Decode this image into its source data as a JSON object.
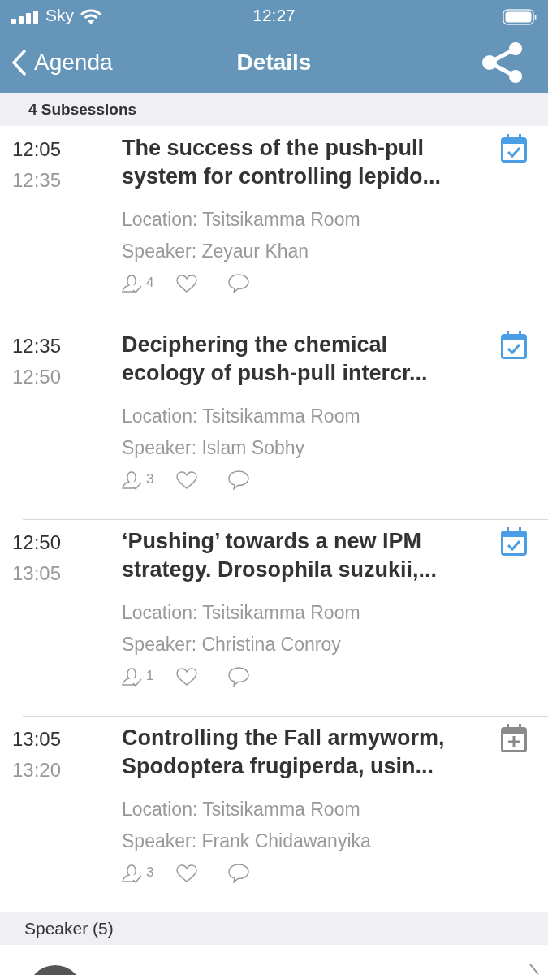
{
  "status_bar": {
    "carrier": "Sky",
    "time": "12:27"
  },
  "nav": {
    "back_label": "Agenda",
    "title": "Details"
  },
  "subsessions_header": "4 Subsessions",
  "sessions": [
    {
      "start": "12:05",
      "end": "12:35",
      "title": "The success of the push-pull system for controlling lepido...",
      "location": "Location: Tsitsikamma Room",
      "speaker": "Speaker: Zeyaur Khan",
      "attendees": "4",
      "in_calendar": true
    },
    {
      "start": "12:35",
      "end": "12:50",
      "title": "Deciphering the chemical ecology of push-pull intercr...",
      "location": "Location: Tsitsikamma Room",
      "speaker": "Speaker: Islam Sobhy",
      "attendees": "3",
      "in_calendar": true
    },
    {
      "start": "12:50",
      "end": "13:05",
      "title": "‘Pushing’ towards a new IPM strategy. Drosophila suzukii,...",
      "location": "Location: Tsitsikamma Room",
      "speaker": "Speaker: Christina Conroy",
      "attendees": "1",
      "in_calendar": true
    },
    {
      "start": "13:05",
      "end": "13:20",
      "title": "Controlling the Fall armyworm, Spodoptera frugiperda, usin...",
      "location": "Location: Tsitsikamma Room",
      "speaker": "Speaker: Frank Chidawanyika",
      "attendees": "3",
      "in_calendar": false
    }
  ],
  "speakers_header": "Speaker (5)"
}
